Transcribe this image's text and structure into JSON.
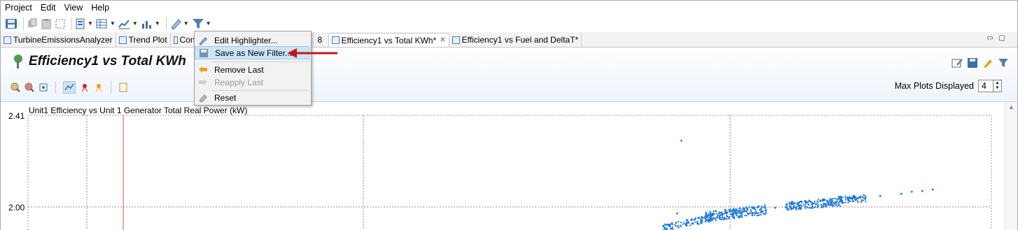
{
  "menubar": {
    "items": [
      "Project",
      "Edit",
      "View",
      "Help"
    ]
  },
  "tabs": [
    {
      "label": "TurbineEmissionsAnalyzer",
      "active": false
    },
    {
      "label": "Trend Plot",
      "active": false
    },
    {
      "label": "Con",
      "active": false
    },
    {
      "label": "Efficiency1 vs Total KWh*",
      "active": true
    },
    {
      "label": "Efficiency1 vs Fuel and DeltaT*",
      "active": false
    }
  ],
  "editor": {
    "title": "Efficiency1 vs Total KWh",
    "max_plots_label": "Max Plots Displayed",
    "max_plots_value": "4"
  },
  "dropdown": {
    "items": [
      {
        "label": "Edit Highlighter...",
        "enabled": true,
        "selected": false
      },
      {
        "label": "Save as New Filter...",
        "enabled": true,
        "selected": true
      },
      {
        "label": "Remove Last",
        "enabled": true,
        "selected": false
      },
      {
        "label": "Reapply Last",
        "enabled": false,
        "selected": false
      },
      {
        "label": "Reset",
        "enabled": true,
        "selected": false
      }
    ]
  },
  "chart_data": {
    "type": "scatter",
    "title": "Unit1 Efficiency vs Unit 1 Generator Total Real Power (kW)",
    "ytick_labels": [
      "2.41",
      "2.00"
    ],
    "marker_color": "#1f77d4",
    "grid": true
  },
  "colors": {
    "accent": "#cce4f7",
    "annotation_arrow": "#c0181e",
    "points": "#1f77d4"
  }
}
